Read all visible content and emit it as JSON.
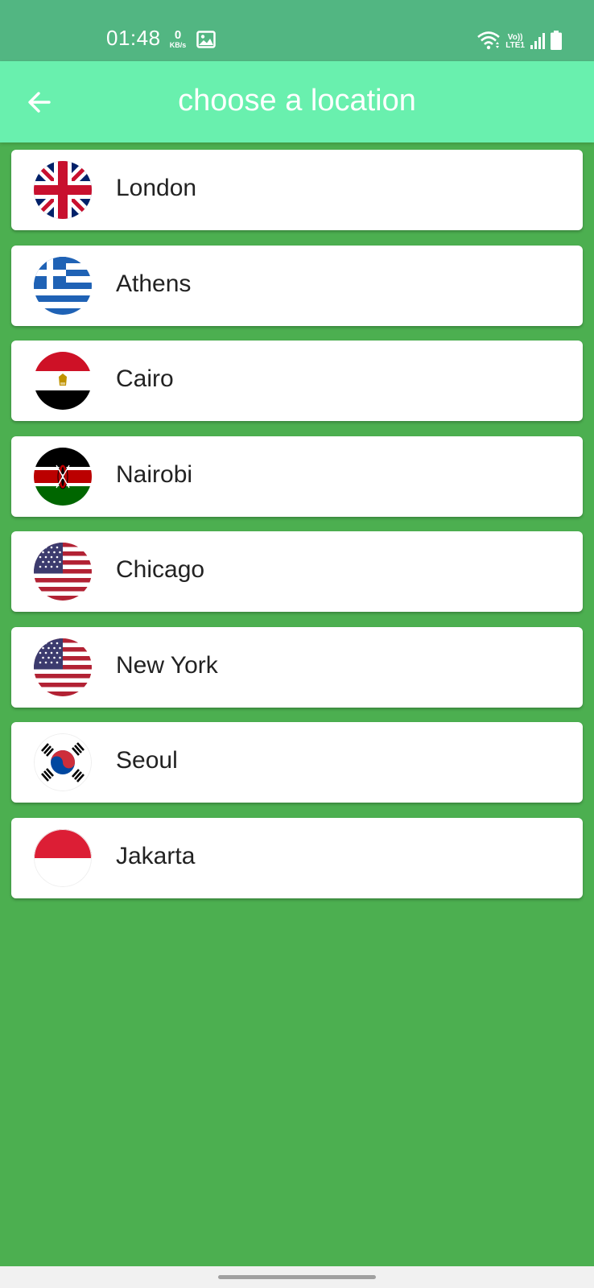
{
  "status_bar": {
    "time": "01:48",
    "net_speed_value": "0",
    "net_speed_unit": "KB/s",
    "volte_label": "Vo))",
    "lte_label": "LTE1",
    "icons": [
      "gallery-icon",
      "wifi-icon",
      "signal-icon",
      "battery-icon"
    ]
  },
  "app_bar": {
    "title": "choose a location",
    "back_icon": "arrow-back-icon"
  },
  "locations": [
    {
      "name": "London",
      "flag": "uk-flag-icon"
    },
    {
      "name": "Athens",
      "flag": "greece-flag-icon"
    },
    {
      "name": "Cairo",
      "flag": "egypt-flag-icon"
    },
    {
      "name": "Nairobi",
      "flag": "kenya-flag-icon"
    },
    {
      "name": "Chicago",
      "flag": "usa-flag-icon"
    },
    {
      "name": "New York",
      "flag": "usa-flag-icon"
    },
    {
      "name": "Seoul",
      "flag": "south-korea-flag-icon"
    },
    {
      "name": "Jakarta",
      "flag": "indonesia-flag-icon"
    }
  ],
  "colors": {
    "status_bar": "#52b682",
    "app_bar": "#69f0ae",
    "background": "#4caf50",
    "card": "#ffffff",
    "text": "#222222"
  }
}
